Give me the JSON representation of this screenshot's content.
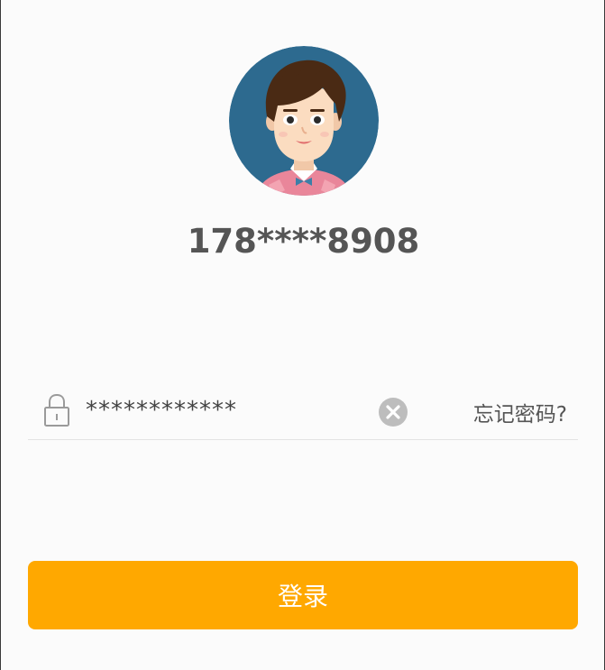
{
  "user": {
    "phone_masked": "178****8908"
  },
  "password_field": {
    "value": "************"
  },
  "icons": {
    "avatar": "avatar-icon",
    "lock": "lock-icon",
    "clear": "clear-icon"
  },
  "links": {
    "forgot_password": "忘记密码?"
  },
  "actions": {
    "login_label": "登录"
  },
  "colors": {
    "accent": "#ffa800",
    "avatar_bg": "#2d6a8f",
    "text": "#555555",
    "divider": "#e3e3e3"
  }
}
